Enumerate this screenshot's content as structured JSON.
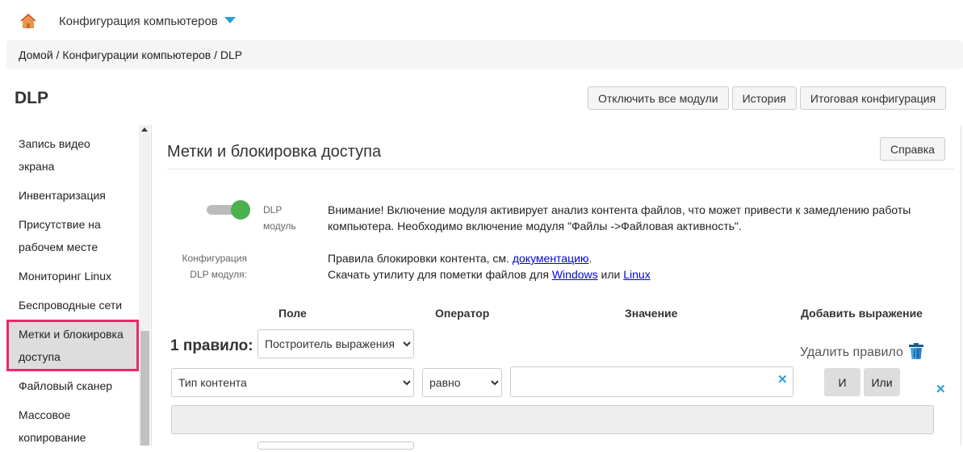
{
  "topnav": {
    "title": "Конфигурация компьютеров"
  },
  "breadcrumb": [
    "Домой",
    "Конфигурации компьютеров",
    "DLP"
  ],
  "page": {
    "title": "DLP",
    "buttons": [
      "Отключить все модули",
      "История",
      "Итоговая конфигурация"
    ]
  },
  "sidebar": {
    "items": [
      "Запись видео экрана",
      "Инвентаризация",
      "Присутствие на рабочем месте",
      "Мониторинг Linux",
      "Беспроводные сети",
      "Метки и блокировка доступа",
      "Файловый сканер",
      "Массовое копирование"
    ],
    "active": 5
  },
  "panel": {
    "title": "Метки и блокировка доступа",
    "help": "Справка",
    "toggle": {
      "label1": "DLP",
      "label2": "модуль",
      "on": true
    },
    "warning": "Внимание! Включение модуля активирует анализ контента файлов, что может привести к замедлению работы компьютера. Необходимо включение модуля \"Файлы ->Файловая активность\".",
    "config_label1": "Конфигурация",
    "config_label2": "DLP модуля:",
    "rules_text": "Правила блокировки контента, см.",
    "rules_link": "документацию",
    "util_text": "Скачать утилиту для пометки файлов для",
    "windows": "Windows",
    "or": "или",
    "linux": "Linux",
    "headers": {
      "field": "Поле",
      "operator": "Оператор",
      "value": "Значение",
      "add": "Добавить выражение"
    },
    "rule": {
      "label": "1 правило:",
      "builder": "Построитель выражения",
      "delete": "Удалить правило",
      "field": "Тип контента",
      "operator": "равно",
      "value": "",
      "and": "И",
      "or": "Или"
    }
  },
  "colors": {
    "accent": "#2a9fd6",
    "active_border": "#f0266b",
    "toggle_on": "#4caf50"
  }
}
